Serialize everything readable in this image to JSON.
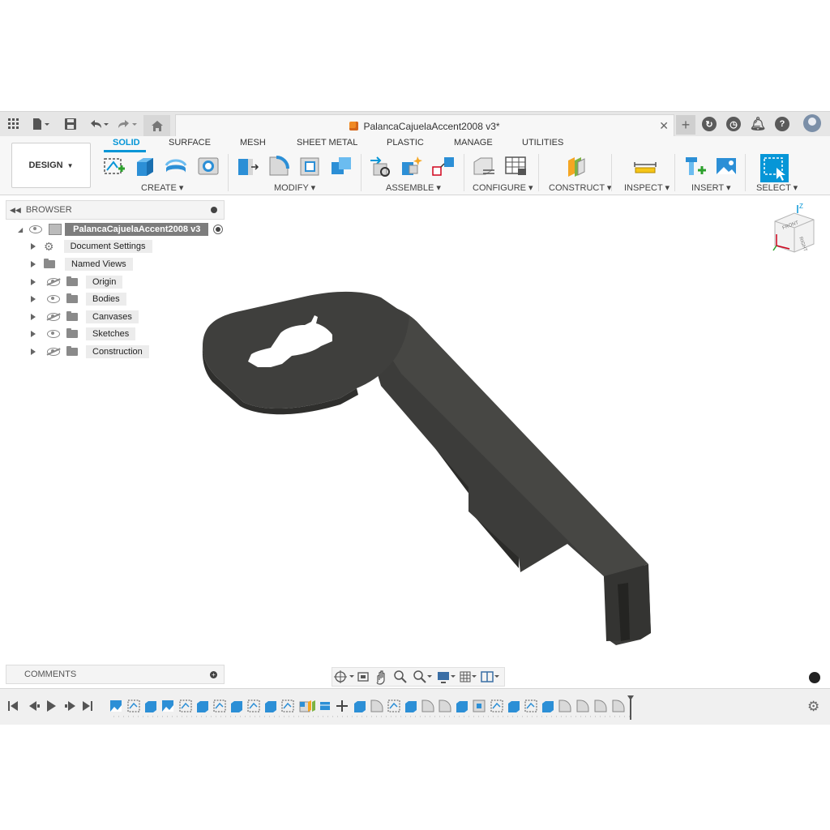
{
  "document": {
    "title": "PalancaCajuelaAccent2008 v3*"
  },
  "workspace": {
    "label": "DESIGN"
  },
  "tabs": [
    {
      "label": "SOLID",
      "active": true
    },
    {
      "label": "SURFACE"
    },
    {
      "label": "MESH"
    },
    {
      "label": "SHEET METAL"
    },
    {
      "label": "PLASTIC"
    },
    {
      "label": "MANAGE"
    },
    {
      "label": "UTILITIES"
    }
  ],
  "groups": {
    "create": "CREATE",
    "modify": "MODIFY",
    "assemble": "ASSEMBLE",
    "configure": "CONFIGURE",
    "construct": "CONSTRUCT",
    "inspect": "INSPECT",
    "insert": "INSERT",
    "select": "SELECT"
  },
  "browser": {
    "title": "BROWSER",
    "root": "PalancaCajuelaAccent2008 v3",
    "items": [
      {
        "label": "Document Settings",
        "icon": "gear-icon"
      },
      {
        "label": "Named Views",
        "icon": "folder-icon"
      },
      {
        "label": "Origin",
        "icon": "folder-icon",
        "visibility": "hidden"
      },
      {
        "label": "Bodies",
        "icon": "folder-icon",
        "visibility": "visible"
      },
      {
        "label": "Canvases",
        "icon": "folder-icon",
        "visibility": "hidden"
      },
      {
        "label": "Sketches",
        "icon": "folder-icon",
        "visibility": "visible"
      },
      {
        "label": "Construction",
        "icon": "folder-icon",
        "visibility": "hidden"
      }
    ]
  },
  "comments": {
    "title": "COMMENTS"
  },
  "viewcube": {
    "face_label": "FRONT",
    "axis": "Z",
    "right_label": "RIGHT"
  },
  "colors": {
    "accent": "#0696d7",
    "model": "#3c3c3a",
    "folder": "#8a8a8a"
  }
}
